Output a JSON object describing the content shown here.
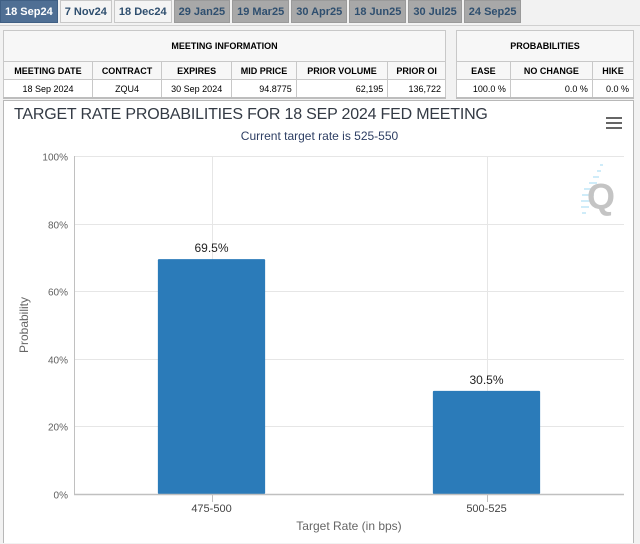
{
  "tabs": [
    {
      "label": "18 Sep24",
      "state": "active"
    },
    {
      "label": "7 Nov24",
      "state": "light"
    },
    {
      "label": "18 Dec24",
      "state": "light"
    },
    {
      "label": "29 Jan25",
      "state": "normal"
    },
    {
      "label": "19 Mar25",
      "state": "normal"
    },
    {
      "label": "30 Apr25",
      "state": "normal"
    },
    {
      "label": "18 Jun25",
      "state": "normal"
    },
    {
      "label": "30 Jul25",
      "state": "normal"
    },
    {
      "label": "24 Sep25",
      "state": "normal"
    }
  ],
  "meeting_info": {
    "caption": "MEETING INFORMATION",
    "headers": [
      "MEETING DATE",
      "CONTRACT",
      "EXPIRES",
      "MID PRICE",
      "PRIOR VOLUME",
      "PRIOR OI"
    ],
    "row": [
      "18 Sep 2024",
      "ZQU4",
      "30 Sep 2024",
      "94.8775",
      "62,195",
      "136,722"
    ]
  },
  "probabilities": {
    "caption": "PROBABILITIES",
    "headers": [
      "EASE",
      "NO CHANGE",
      "HIKE"
    ],
    "row": [
      "100.0 %",
      "0.0 %",
      "0.0 %"
    ]
  },
  "chart": {
    "menu_icon": "hamburger-menu-icon",
    "watermark_icon": "quikstrike-q-logo-icon"
  },
  "chart_data": {
    "type": "bar",
    "title": "TARGET RATE PROBABILITIES FOR 18 SEP 2024 FED MEETING",
    "subtitle": "Current target rate is 525-550",
    "xlabel": "Target Rate (in bps)",
    "ylabel": "Probability",
    "categories": [
      "475-500",
      "500-525"
    ],
    "values": [
      69.5,
      30.5
    ],
    "data_labels": [
      "69.5%",
      "30.5%"
    ],
    "ylim": [
      0,
      100
    ],
    "yticks": [
      0,
      20,
      40,
      60,
      80,
      100
    ],
    "ytick_labels": [
      "0%",
      "20%",
      "40%",
      "60%",
      "80%",
      "100%"
    ],
    "grid": true,
    "legend": "none",
    "bar_color": "#2b7bb9"
  }
}
